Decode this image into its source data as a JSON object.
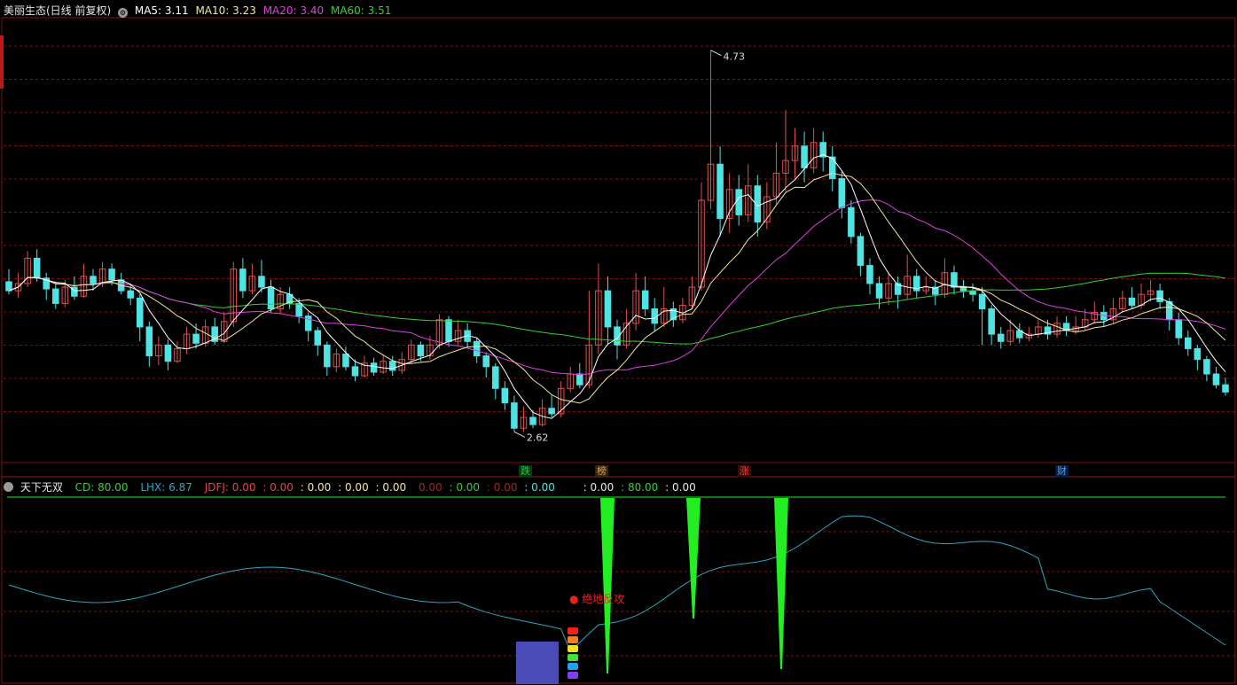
{
  "header": {
    "title": "美丽生态(日线 前复权)",
    "ma5_label": "MA5: 3.11",
    "ma10_label": "MA10: 3.23",
    "ma20_label": "MA20: 3.40",
    "ma60_label": "MA60: 3.51"
  },
  "indicator_header": {
    "name": "天下无双",
    "cd": "CD: 80.00",
    "lhx": "LHX: 6.87",
    "jdfj": "JDFJ: 0.00",
    "v1": ": 0.00",
    "v2": ": 0.00",
    "v3": ": 0.00",
    "v4": ": 0.00",
    "v5": "0.00",
    "v6": ": 0.00",
    "v7": ": 0.00",
    "v8": ": 0.00",
    "v9": ": 0.00",
    "v10": ": 80.00",
    "v11": ": 0.00"
  },
  "tags": [
    {
      "text": "跌",
      "color": "#19c94a"
    },
    {
      "text": "榜",
      "color": "#e2a24a"
    },
    {
      "text": "涨",
      "color": "#f04040"
    },
    {
      "text": "财",
      "color": "#4aa0f0"
    }
  ],
  "annotation": "绝地反攻",
  "colors": {
    "up": "#e0514a",
    "down": "#4fe3e3",
    "ma5": "#ffffff",
    "ma10": "#f4e6a0",
    "ma20": "#e040e0",
    "ma60": "#32d232",
    "grid": "#7a1414",
    "indicator_line": "#2aa8c0",
    "spike": "#22ee22",
    "box": "#4a4ab8"
  },
  "chart_data": {
    "type": "candlestick",
    "high_label": "4.73",
    "low_label": "2.62",
    "ylim": [
      2.45,
      4.9
    ],
    "candles": [
      [
        3.45,
        3.4,
        3.52,
        3.38
      ],
      [
        3.4,
        3.44,
        3.5,
        3.36
      ],
      [
        3.44,
        3.58,
        3.62,
        3.42
      ],
      [
        3.58,
        3.47,
        3.63,
        3.45
      ],
      [
        3.47,
        3.41,
        3.5,
        3.35
      ],
      [
        3.41,
        3.33,
        3.45,
        3.3
      ],
      [
        3.33,
        3.42,
        3.46,
        3.31
      ],
      [
        3.42,
        3.37,
        3.48,
        3.35
      ],
      [
        3.37,
        3.48,
        3.55,
        3.36
      ],
      [
        3.48,
        3.44,
        3.52,
        3.4
      ],
      [
        3.44,
        3.52,
        3.56,
        3.42
      ],
      [
        3.52,
        3.46,
        3.55,
        3.43
      ],
      [
        3.46,
        3.4,
        3.5,
        3.38
      ],
      [
        3.4,
        3.36,
        3.44,
        3.32
      ],
      [
        3.36,
        3.2,
        3.38,
        3.12
      ],
      [
        3.2,
        3.04,
        3.23,
        2.98
      ],
      [
        3.04,
        3.1,
        3.15,
        2.99
      ],
      [
        3.1,
        3.01,
        3.13,
        2.96
      ],
      [
        3.01,
        3.08,
        3.12,
        3.0
      ],
      [
        3.08,
        3.16,
        3.2,
        3.05
      ],
      [
        3.16,
        3.11,
        3.22,
        3.08
      ],
      [
        3.11,
        3.2,
        3.24,
        3.09
      ],
      [
        3.2,
        3.12,
        3.25,
        3.1
      ],
      [
        3.12,
        3.23,
        3.28,
        3.11
      ],
      [
        3.23,
        3.52,
        3.56,
        3.2
      ],
      [
        3.52,
        3.4,
        3.58,
        3.36
      ],
      [
        3.4,
        3.48,
        3.55,
        3.38
      ],
      [
        3.48,
        3.42,
        3.57,
        3.39
      ],
      [
        3.42,
        3.3,
        3.46,
        3.28
      ],
      [
        3.3,
        3.38,
        3.42,
        3.27
      ],
      [
        3.38,
        3.33,
        3.42,
        3.3
      ],
      [
        3.33,
        3.26,
        3.36,
        3.22
      ],
      [
        3.26,
        3.18,
        3.28,
        3.12
      ],
      [
        3.18,
        3.1,
        3.2,
        3.04
      ],
      [
        3.1,
        2.98,
        3.12,
        2.93
      ],
      [
        2.98,
        3.05,
        3.08,
        2.95
      ],
      [
        3.05,
        2.98,
        3.09,
        2.96
      ],
      [
        2.98,
        2.93,
        3.02,
        2.9
      ],
      [
        2.93,
        3.0,
        3.04,
        2.92
      ],
      [
        3.0,
        2.95,
        3.03,
        2.93
      ],
      [
        2.95,
        3.01,
        3.05,
        2.94
      ],
      [
        3.01,
        2.96,
        3.04,
        2.93
      ],
      [
        2.96,
        3.02,
        3.06,
        2.94
      ],
      [
        3.02,
        3.1,
        3.13,
        3.0
      ],
      [
        3.1,
        3.04,
        3.12,
        3.01
      ],
      [
        3.04,
        3.1,
        3.15,
        3.02
      ],
      [
        3.1,
        3.24,
        3.27,
        3.08
      ],
      [
        3.24,
        3.12,
        3.26,
        3.09
      ],
      [
        3.12,
        3.18,
        3.24,
        3.1
      ],
      [
        3.18,
        3.12,
        3.22,
        3.09
      ],
      [
        3.12,
        3.04,
        3.14,
        3.0
      ],
      [
        3.04,
        2.98,
        3.06,
        2.92
      ],
      [
        2.98,
        2.86,
        3.0,
        2.8
      ],
      [
        2.86,
        2.78,
        2.9,
        2.74
      ],
      [
        2.78,
        2.64,
        2.82,
        2.62
      ],
      [
        2.64,
        2.7,
        2.76,
        2.62
      ],
      [
        2.7,
        2.66,
        2.74,
        2.64
      ],
      [
        2.66,
        2.75,
        2.8,
        2.65
      ],
      [
        2.75,
        2.72,
        2.82,
        2.7
      ],
      [
        2.72,
        2.86,
        2.9,
        2.7
      ],
      [
        2.86,
        2.94,
        2.98,
        2.84
      ],
      [
        2.94,
        2.88,
        3.0,
        2.86
      ],
      [
        2.88,
        3.1,
        3.4,
        2.86
      ],
      [
        3.1,
        3.4,
        3.55,
        3.05
      ],
      [
        3.4,
        3.2,
        3.48,
        3.1
      ],
      [
        3.2,
        3.1,
        3.24,
        3.02
      ],
      [
        3.1,
        3.22,
        3.3,
        3.08
      ],
      [
        3.22,
        3.4,
        3.5,
        3.18
      ],
      [
        3.4,
        3.3,
        3.48,
        3.26
      ],
      [
        3.3,
        3.22,
        3.36,
        3.18
      ],
      [
        3.22,
        3.3,
        3.42,
        3.2
      ],
      [
        3.3,
        3.24,
        3.34,
        3.2
      ],
      [
        3.24,
        3.32,
        3.36,
        3.22
      ],
      [
        3.32,
        3.42,
        3.48,
        3.3
      ],
      [
        3.42,
        3.9,
        4.0,
        3.4
      ],
      [
        3.9,
        4.1,
        4.73,
        3.85
      ],
      [
        4.1,
        3.8,
        4.2,
        3.7
      ],
      [
        3.8,
        3.96,
        4.05,
        3.72
      ],
      [
        3.96,
        3.82,
        4.04,
        3.76
      ],
      [
        3.82,
        3.98,
        4.1,
        3.78
      ],
      [
        3.98,
        3.78,
        4.04,
        3.7
      ],
      [
        3.78,
        3.92,
        4.0,
        3.74
      ],
      [
        3.92,
        4.05,
        4.22,
        3.88
      ],
      [
        4.05,
        4.12,
        4.4,
        3.95
      ],
      [
        4.12,
        4.2,
        4.3,
        4.02
      ],
      [
        4.2,
        4.08,
        4.28,
        4.0
      ],
      [
        4.08,
        4.22,
        4.3,
        4.05
      ],
      [
        4.22,
        4.14,
        4.28,
        4.06
      ],
      [
        4.14,
        4.02,
        4.2,
        3.95
      ],
      [
        4.02,
        3.86,
        4.06,
        3.8
      ],
      [
        3.86,
        3.7,
        3.9,
        3.66
      ],
      [
        3.7,
        3.54,
        3.72,
        3.48
      ],
      [
        3.54,
        3.44,
        3.58,
        3.38
      ],
      [
        3.44,
        3.36,
        3.48,
        3.3
      ],
      [
        3.36,
        3.44,
        3.5,
        3.32
      ],
      [
        3.44,
        3.38,
        3.48,
        3.3
      ],
      [
        3.38,
        3.48,
        3.6,
        3.35
      ],
      [
        3.48,
        3.4,
        3.52,
        3.36
      ],
      [
        3.4,
        3.42,
        3.48,
        3.38
      ],
      [
        3.42,
        3.38,
        3.46,
        3.32
      ],
      [
        3.38,
        3.5,
        3.58,
        3.36
      ],
      [
        3.5,
        3.42,
        3.54,
        3.38
      ],
      [
        3.42,
        3.4,
        3.46,
        3.36
      ],
      [
        3.4,
        3.38,
        3.44,
        3.34
      ],
      [
        3.38,
        3.3,
        3.42,
        3.1
      ],
      [
        3.3,
        3.16,
        3.32,
        3.1
      ],
      [
        3.16,
        3.12,
        3.2,
        3.08
      ],
      [
        3.12,
        3.18,
        3.24,
        3.1
      ],
      [
        3.18,
        3.14,
        3.22,
        3.11
      ],
      [
        3.14,
        3.16,
        3.2,
        3.12
      ],
      [
        3.16,
        3.2,
        3.24,
        3.14
      ],
      [
        3.2,
        3.16,
        3.24,
        3.13
      ],
      [
        3.16,
        3.22,
        3.26,
        3.14
      ],
      [
        3.22,
        3.18,
        3.26,
        3.15
      ],
      [
        3.18,
        3.2,
        3.26,
        3.16
      ],
      [
        3.2,
        3.24,
        3.3,
        3.18
      ],
      [
        3.24,
        3.28,
        3.34,
        3.22
      ],
      [
        3.28,
        3.24,
        3.32,
        3.2
      ],
      [
        3.24,
        3.3,
        3.36,
        3.22
      ],
      [
        3.3,
        3.36,
        3.4,
        3.28
      ],
      [
        3.36,
        3.32,
        3.42,
        3.3
      ],
      [
        3.32,
        3.38,
        3.44,
        3.3
      ],
      [
        3.38,
        3.4,
        3.46,
        3.34
      ],
      [
        3.4,
        3.34,
        3.44,
        3.3
      ],
      [
        3.34,
        3.24,
        3.36,
        3.18
      ],
      [
        3.24,
        3.14,
        3.28,
        3.1
      ],
      [
        3.14,
        3.08,
        3.18,
        3.04
      ],
      [
        3.08,
        3.02,
        3.1,
        2.96
      ],
      [
        3.02,
        2.94,
        3.04,
        2.9
      ],
      [
        2.94,
        2.88,
        2.98,
        2.86
      ],
      [
        2.88,
        2.84,
        2.92,
        2.82
      ]
    ]
  }
}
